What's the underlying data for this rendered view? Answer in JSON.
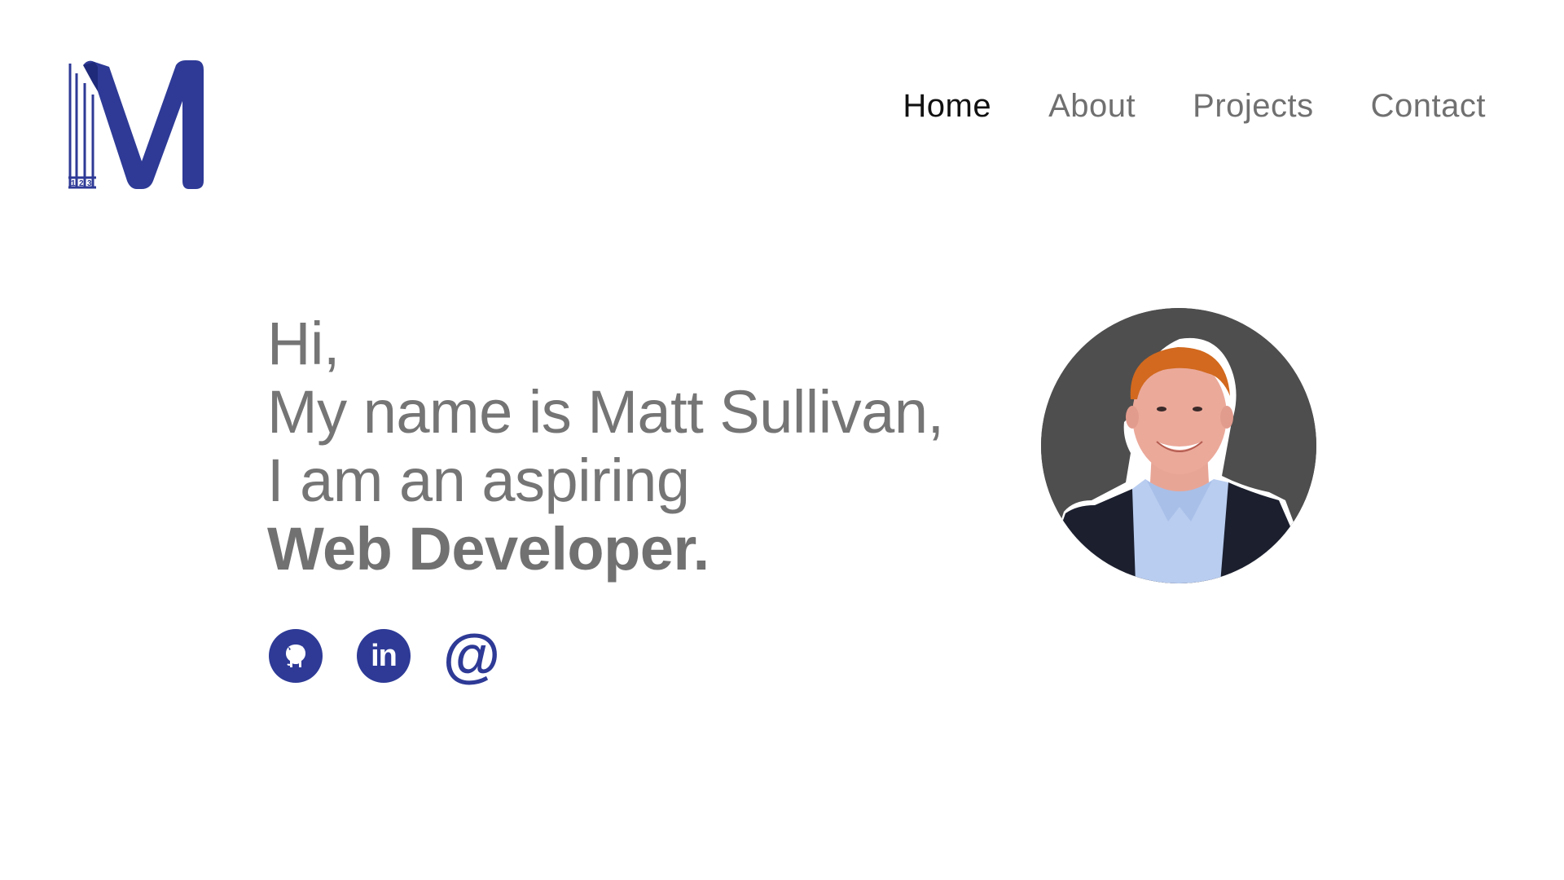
{
  "colors": {
    "brand": "#2e3a96",
    "nav_active": "#111111",
    "nav_inactive": "#707070",
    "hero_text": "#6e6e6e",
    "avatar_bg": "#4e4e4e"
  },
  "logo": {
    "letter": "M",
    "digits": [
      "1",
      "2",
      "3"
    ]
  },
  "nav": {
    "items": [
      {
        "label": "Home",
        "active": true
      },
      {
        "label": "About",
        "active": false
      },
      {
        "label": "Projects",
        "active": false
      },
      {
        "label": "Contact",
        "active": false
      }
    ]
  },
  "hero": {
    "line1": "Hi,",
    "line2": "My name is Matt Sullivan,",
    "line3": "I am  an aspiring",
    "line4": "Web Developer."
  },
  "social": {
    "github_icon": "github-icon",
    "linkedin_icon": "linkedin-icon",
    "linkedin_text": "in",
    "email_symbol": "@"
  },
  "avatar": {
    "icon": "profile-photo"
  }
}
